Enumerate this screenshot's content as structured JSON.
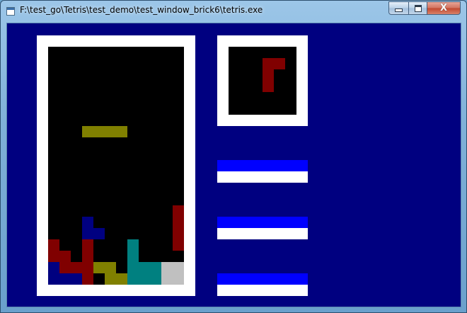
{
  "window": {
    "title": "F:\\test_go\\Tetris\\test_demo\\test_window_brick6\\tetris.exe",
    "buttons": {
      "minimize_glyph": "—",
      "maximize_glyph": "□",
      "close_glyph": "X"
    }
  },
  "colors": {
    "background": "#000080",
    "frame": "#ffffff",
    "well": "#000000",
    "stat_top": "#0000ff",
    "stat_bottom": "#ffffff"
  },
  "board": {
    "cols": 12,
    "rows": 21,
    "active_piece": {
      "shape": "I",
      "color": "#808000",
      "cells": [
        [
          8,
          3
        ],
        [
          8,
          4
        ],
        [
          8,
          5
        ],
        [
          8,
          6
        ]
      ]
    },
    "settled_cells": [
      [
        15,
        11,
        "#800000"
      ],
      [
        16,
        11,
        "#800000"
      ],
      [
        17,
        11,
        "#800000"
      ],
      [
        18,
        11,
        "#800000"
      ],
      [
        16,
        3,
        "#000080"
      ],
      [
        17,
        3,
        "#000080"
      ],
      [
        17,
        4,
        "#000080"
      ],
      [
        18,
        0,
        "#800000"
      ],
      [
        19,
        0,
        "#800000"
      ],
      [
        19,
        1,
        "#800000"
      ],
      [
        18,
        3,
        "#800000"
      ],
      [
        19,
        3,
        "#800000"
      ],
      [
        18,
        7,
        "#008080"
      ],
      [
        19,
        7,
        "#008080"
      ],
      [
        20,
        0,
        "#000080"
      ],
      [
        21,
        0,
        "#000080"
      ],
      [
        21,
        1,
        "#000080"
      ],
      [
        21,
        2,
        "#000080"
      ],
      [
        20,
        1,
        "#800000"
      ],
      [
        20,
        2,
        "#800000"
      ],
      [
        20,
        3,
        "#800000"
      ],
      [
        21,
        3,
        "#800000"
      ],
      [
        20,
        4,
        "#808000"
      ],
      [
        20,
        5,
        "#808000"
      ],
      [
        21,
        5,
        "#808000"
      ],
      [
        21,
        6,
        "#808000"
      ],
      [
        20,
        7,
        "#008080"
      ],
      [
        21,
        7,
        "#008080"
      ],
      [
        20,
        8,
        "#008080"
      ],
      [
        21,
        8,
        "#008080"
      ],
      [
        20,
        9,
        "#008080"
      ],
      [
        21,
        9,
        "#008080"
      ],
      [
        20,
        10,
        "#c0c0c0"
      ],
      [
        21,
        10,
        "#c0c0c0"
      ],
      [
        20,
        11,
        "#c0c0c0"
      ],
      [
        21,
        11,
        "#c0c0c0"
      ]
    ]
  },
  "next_piece": {
    "shape": "J",
    "color": "#800000",
    "cells": [
      [
        1,
        3
      ],
      [
        1,
        4
      ],
      [
        2,
        3
      ],
      [
        3,
        3
      ]
    ]
  },
  "stat_bars": [
    {
      "name": "stat-bar-1"
    },
    {
      "name": "stat-bar-2"
    },
    {
      "name": "stat-bar-3"
    }
  ]
}
